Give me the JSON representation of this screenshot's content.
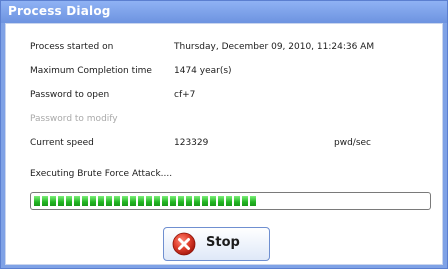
{
  "window": {
    "title": "Process Dialog"
  },
  "details": [
    {
      "label": "Process started on",
      "value": "Thursday, December 09, 2010, 11:24:36 AM"
    },
    {
      "label": "Maximum Completion time",
      "value": "1474 year(s)"
    },
    {
      "label": "Password to open",
      "value": "cf+7"
    },
    {
      "label": "Password to modify",
      "value": ""
    },
    {
      "label": "Current speed",
      "value": "123329",
      "unit": "pwd/sec"
    }
  ],
  "status_text": "Executing Brute Force Attack....",
  "progress": {
    "segments_filled": 28,
    "color": "#23b523"
  },
  "stop_button": {
    "label": "Stop",
    "icon": "x-circle-icon",
    "icon_color": "#d83a2a"
  }
}
